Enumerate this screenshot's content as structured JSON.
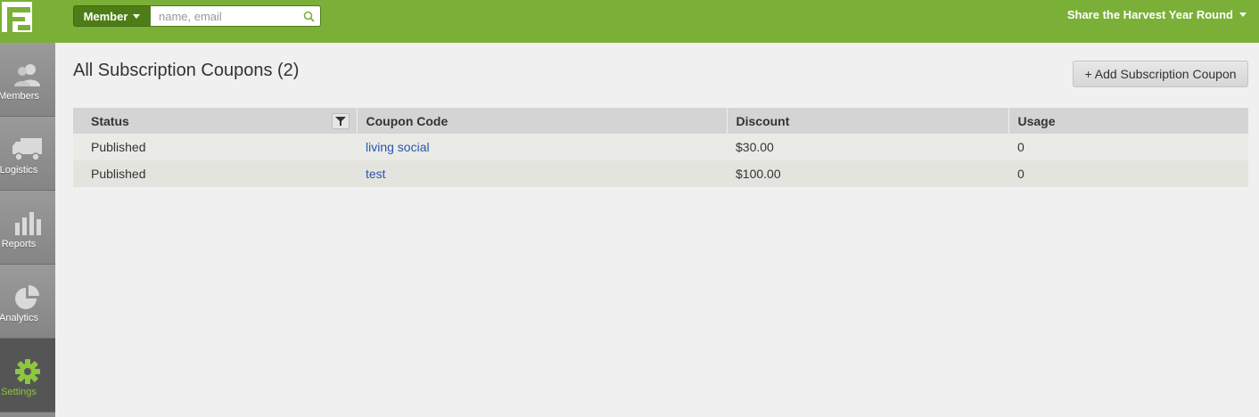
{
  "header": {
    "search_scope": "Member",
    "search_placeholder": "name, email",
    "search_value": "",
    "org_name": "Share the Harvest Year Round"
  },
  "sidebar": {
    "items": [
      {
        "label": "Members",
        "icon": "members-icon"
      },
      {
        "label": "Logistics",
        "icon": "truck-icon"
      },
      {
        "label": "Reports",
        "icon": "bar-chart-icon"
      },
      {
        "label": "Analytics",
        "icon": "pie-chart-icon"
      },
      {
        "label": "Settings",
        "icon": "gear-icon",
        "active": true
      }
    ]
  },
  "main": {
    "title": "All Subscription Coupons (2)",
    "add_button_label": "+ Add Subscription Coupon",
    "table": {
      "headers": [
        "Status",
        "Coupon Code",
        "Discount",
        "Usage"
      ],
      "rows": [
        {
          "status": "Published",
          "code": "living social",
          "discount": "$30.00",
          "usage": "0"
        },
        {
          "status": "Published",
          "code": "test",
          "discount": "$100.00",
          "usage": "0"
        }
      ]
    }
  },
  "colors": {
    "brand_green": "#7ab037",
    "dark_green": "#4e7d18",
    "link_blue": "#2a55b0",
    "active_green": "#8dc63f"
  }
}
